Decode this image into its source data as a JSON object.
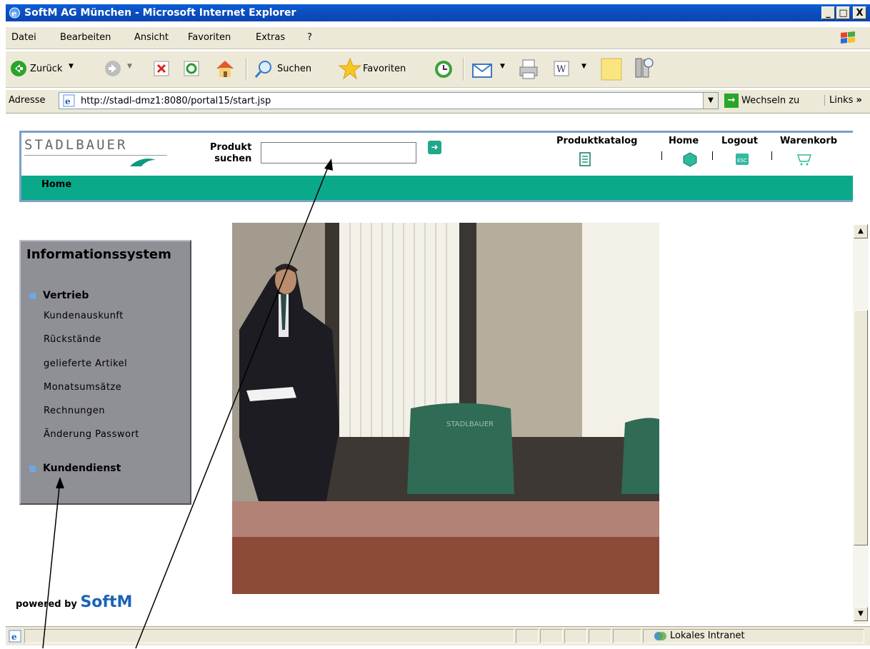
{
  "window": {
    "title": "SoftM AG München - Microsoft Internet Explorer",
    "minimize": "_",
    "maximize": "□",
    "close": "X"
  },
  "menu": [
    "Datei",
    "Bearbeiten",
    "Ansicht",
    "Favoriten",
    "Extras",
    "?"
  ],
  "toolbar": {
    "back": "Zurück",
    "search": "Suchen",
    "favorites": "Favoriten"
  },
  "address": {
    "label": "Adresse",
    "url": "http://stadl-dmz1:8080/portal15/start.jsp",
    "go": "Wechseln zu",
    "links": "Links",
    "links_chevron": "»"
  },
  "portal": {
    "logo": "STADLBAUER",
    "search_label_1": "Produkt",
    "search_label_2": "suchen",
    "search_value": "",
    "nav": [
      "Produktkatalog",
      "Home",
      "Logout",
      "Warenkorb"
    ],
    "breadcrumb": "Home"
  },
  "sidebar": {
    "title": "Informationssystem",
    "section1": "Vertrieb",
    "items": [
      "Kundenauskunft",
      "Rückstände",
      "gelieferte Artikel",
      "Monatsumsätze",
      "Rechnungen",
      "Änderung Passwort"
    ],
    "section2": "Kundendienst"
  },
  "photo": {
    "chair_logo": "STADLBAUER"
  },
  "footer": {
    "powered_by": "powered by",
    "brand": "SoftM"
  },
  "status": {
    "zone": "Lokales Intranet"
  },
  "colors": {
    "titlebar": "#0a46b4",
    "portal_green": "#0aa98a",
    "sidebar_gray": "#8f8f96"
  }
}
